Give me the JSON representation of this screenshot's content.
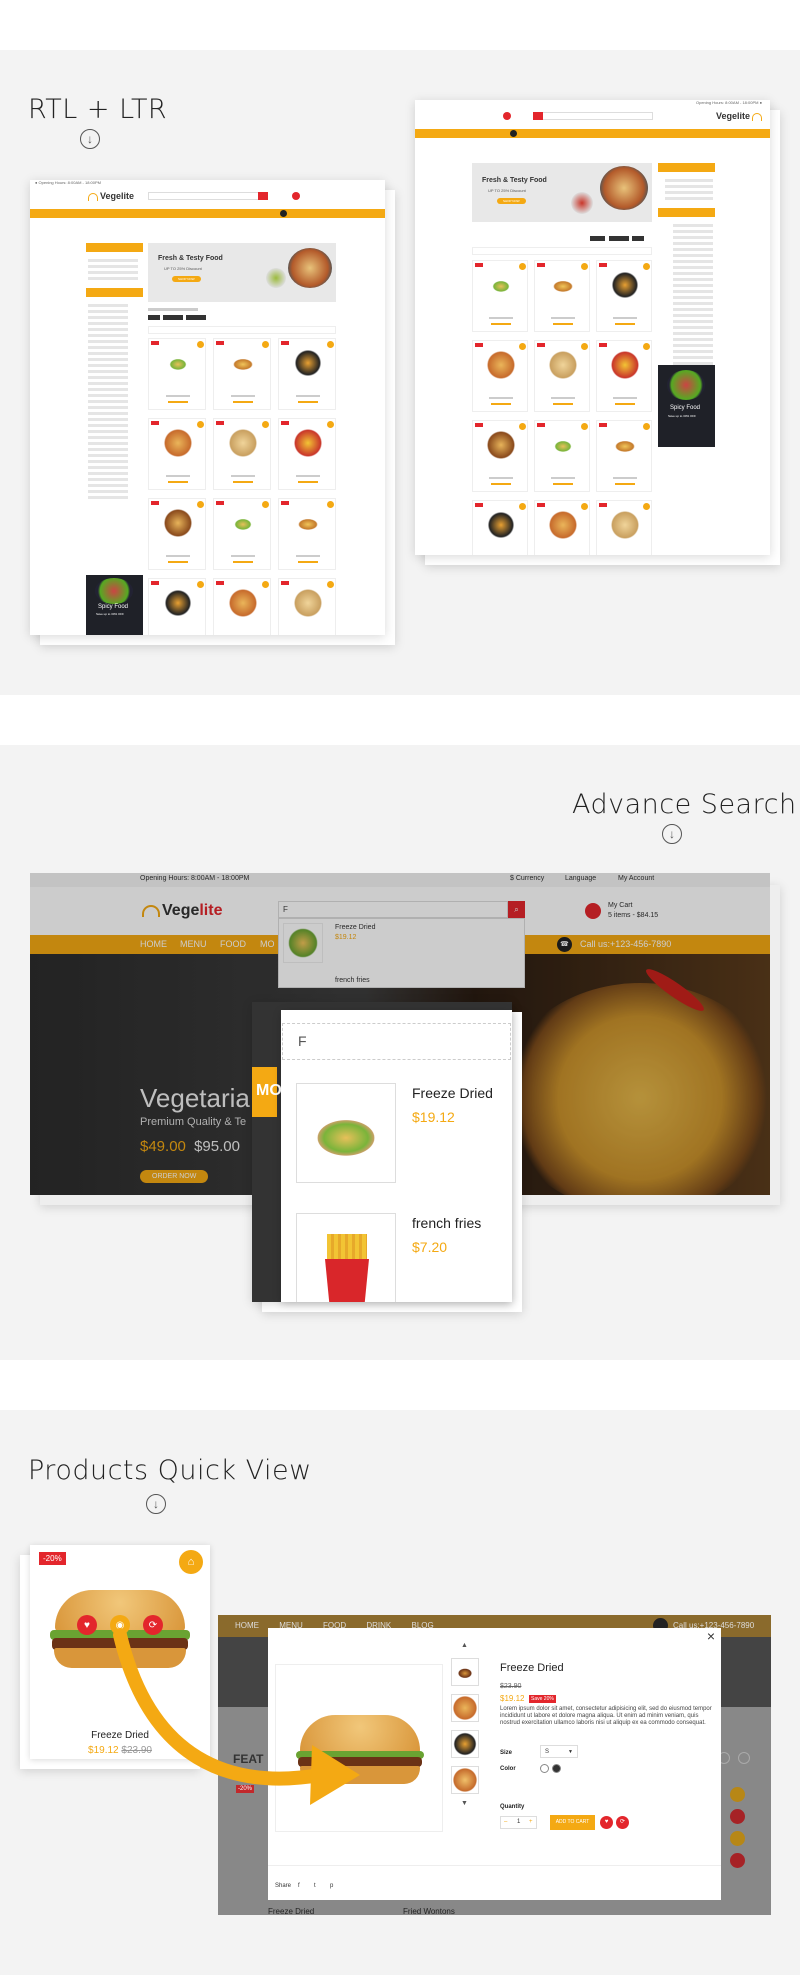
{
  "sections": {
    "rtl": {
      "title": "RTL + LTR"
    },
    "search": {
      "title": "Advance Search"
    },
    "quickview": {
      "title": "Products Quick View"
    }
  },
  "ltr_shot": {
    "brand": "Vegelite",
    "promo_title": "Fresh & Testy Food",
    "promo_sub": "UP TO 25% Discount",
    "promo_btn": "SHOP NOW",
    "spicy_title": "Spicy Food",
    "spicy_sub": "Save up to 30% OFF"
  },
  "rtl_shot": {
    "brand": "Vegelite",
    "promo_title": "Fresh & Testy Food",
    "promo_sub": "UP TO 25% Discount",
    "promo_btn": "SHOP NOW",
    "spicy_title": "Spicy Food",
    "spicy_sub": "Save up to 30% OFF"
  },
  "search_shot": {
    "opening_hours": "Opening Hours: 8:00AM - 18:00PM",
    "currency": "$ Currency",
    "language": "Language",
    "account": "My Account",
    "brand_a": "Vege",
    "brand_b": "lite",
    "search_value": "F",
    "cart_label": "My Cart",
    "cart_summary": "5 items - $84.15",
    "nav": [
      "HOME",
      "MENU",
      "FOOD",
      "MO"
    ],
    "call": "Call us:+123-456-7890",
    "hero_title": "Vegetaria",
    "hero_sub": "Premium Quality & Te",
    "hero_price": "$49.00",
    "hero_old": "$95.00",
    "hero_btn": "ORDER NOW",
    "hero_mo": "MO",
    "results_small": [
      {
        "name": "Freeze Dried",
        "price": "$19.12"
      },
      {
        "name": "french fries",
        "price": "$7.20"
      }
    ],
    "results_big": [
      {
        "name": "Freeze Dried",
        "price": "$19.12"
      },
      {
        "name": "french fries",
        "price": "$7.20"
      }
    ]
  },
  "quickview": {
    "card": {
      "discount": "-20%",
      "name": "Freeze Dried",
      "price": "$19.12",
      "old_price": "$23.90"
    },
    "bg_nav": [
      "HOME",
      "MENU",
      "FOOD",
      "DRINK",
      "BLOG"
    ],
    "bg_call": "Call us:+123-456-7890",
    "bg_feat": "FEAT",
    "bg_discount": "-20%",
    "bg_names": [
      "Freeze Dried",
      "Fried Wontons"
    ],
    "modal": {
      "close": "×",
      "title": "Freeze Dried",
      "old_price": "$23.90",
      "price": "$19.12",
      "save": "Save 20%",
      "desc": "Lorem ipsum dolor sit amet, consectetur adipisicing elit, sed do eiusmod tempor incididunt ut labore et dolore magna aliqua. Ut enim ad minim veniam, quis nostrud exercitation ullamco laboris nisi ut aliquip ex ea commodo consequat.",
      "size_label": "Size",
      "size_value": "S",
      "color_label": "Color",
      "qty_label": "Quantity",
      "qty_value": "1",
      "qty_minus": "–",
      "qty_plus": "+",
      "add_btn": "ADD TO CART",
      "share_label": "Share",
      "share_icons": [
        "f",
        "t",
        "p"
      ]
    }
  },
  "colors": {
    "accent": "#f4a913",
    "red": "#e3262c",
    "bg": "#f3f3f3"
  }
}
